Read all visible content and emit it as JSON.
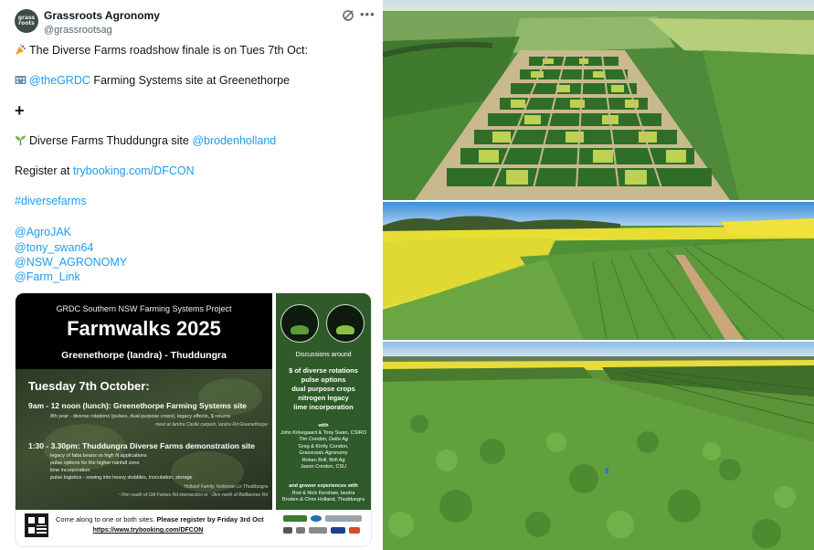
{
  "tweet": {
    "avatar_text": "grass roots",
    "author_name": "Grassroots Agronomy",
    "author_handle": "@grassrootsag",
    "more_label": "•••",
    "line1": "The Diverse Farms roadshow finale is on Tues 7th Oct:",
    "line2_link": "@theGRDC",
    "line2_rest": " Farming Systems site at Greenethorpe",
    "plus": "+",
    "line3_text": "Diverse Farms Thuddungra site ",
    "line3_link": "@brodenholland",
    "register_text": "Register at ",
    "register_link": "trybooking.com/DFCON",
    "hashtag": "#diversefarms",
    "mentions": [
      "@AgroJAK",
      "@tony_swan64",
      "@NSW_AGRONOMY",
      "@Farm_Link"
    ]
  },
  "flyer": {
    "project": "GRDC Southern NSW Farming Systems Project",
    "title": "Farmwalks 2025",
    "location": "Greenethorpe (Iandra) - Thuddungra",
    "date": "Tuesday 7th October:",
    "session1_title": "9am - 12 noon (lunch): Greenethorpe Farming Systems site",
    "session1_detail": "8th year - diverse rotations (pulses, dual purpose crops), legacy effects, $ returns",
    "session1_meet": "meet at Iandra Castle carpark, Iandra Rd Greenethorpe",
    "session2_title": "1:30 - 3.30pm: Thuddungra Diverse Farms demonstration site",
    "session2_items": [
      "legacy of faba beans vs high N applications",
      "pulse options for the higher rainfall zone",
      "lime incorporation",
      "pulse logistics - sowing into heavy stubbles, inoculation, storage"
    ],
    "session2_meet1": "Holland Family, Kelloman Ln Thuddungra",
    "session2_meet2": "~7km south of Old Forbes Rd intersection or ~2km north of Bellbooree Rd",
    "discussions": "Discussions around",
    "topics": [
      "$ of diverse rotations",
      "pulse options",
      "dual purpose crops",
      "nitrogen legacy",
      "lime incorporation"
    ],
    "with_label": "with",
    "speakers": [
      "John Kirkegaard & Tony Swan, CSIRO",
      "Tim Condon, Delta Ag",
      "Greg & Kirrily Condon,",
      "Grassroots Agronomy",
      "Rohan Brill, Brill Ag",
      "Jason Condon, CSU"
    ],
    "grower": [
      "and grower experiences with",
      "Rod & Nick Kershaw, Iandra",
      "Broden & Chris Holland, Thuddungra"
    ],
    "come_text": "Come along to one or both sites. ",
    "come_bold": "Please register by Friday 3rd Oct",
    "url": "https://www.trybooking.com/DFCON"
  }
}
